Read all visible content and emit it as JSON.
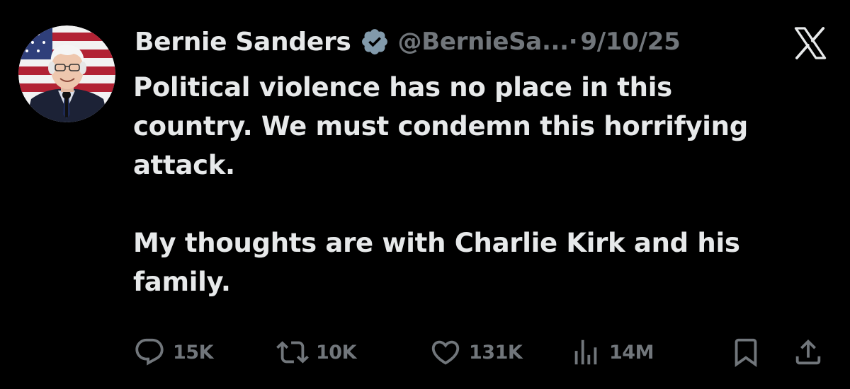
{
  "tweet": {
    "author": {
      "display_name": "Bernie Sanders",
      "handle": "@BernieSa...",
      "verified": true,
      "verified_icon": "verified-badge-icon"
    },
    "separator": "·",
    "date": "9/10/25",
    "platform_icon": "x-logo-icon",
    "text_paragraphs": [
      "Political violence has no place in this",
      "country. We must condemn this horrifying",
      "attack.",
      "My thoughts are with Charlie Kirk and his",
      "family."
    ],
    "stats": {
      "replies": "15K",
      "reposts": "10K",
      "likes": "131K",
      "views": "14M"
    }
  },
  "colors": {
    "background": "#000000",
    "primary_text": "#e7e9ea",
    "secondary_text": "#71767b",
    "verified_badge": "#829aab"
  },
  "icons": {
    "reply": "reply-icon",
    "repost": "repost-icon",
    "like": "heart-icon",
    "views": "views-chart-icon",
    "bookmark": "bookmark-icon",
    "share": "share-icon"
  }
}
